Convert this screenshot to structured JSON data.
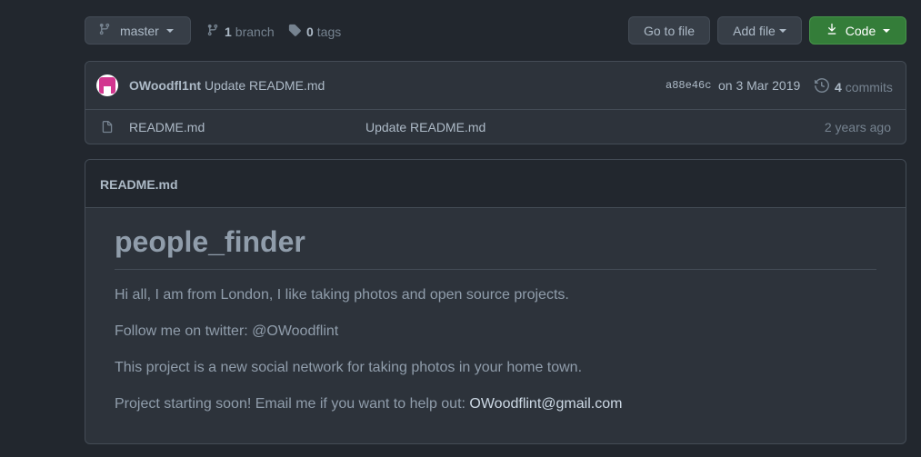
{
  "branch": {
    "current": "master",
    "branch_count": "1",
    "branch_label": "branch",
    "tag_count": "0",
    "tag_label": "tags"
  },
  "actions": {
    "goto_file": "Go to file",
    "add_file": "Add file",
    "code": "Code"
  },
  "commit": {
    "author": "OWoodfl1nt",
    "message": "Update README.md",
    "sha": "a88e46c",
    "date": "on 3 Mar 2019",
    "count": "4",
    "count_label": "commits"
  },
  "files": [
    {
      "name": "README.md",
      "last_commit": "Update README.md",
      "age": "2 years ago"
    }
  ],
  "readme": {
    "filename": "README.md",
    "heading": "people_finder",
    "paragraphs": [
      "Hi all, I am from London, I like taking photos and open source projects.",
      "Follow me on twitter: @OWoodflint",
      "This project is a new social network for taking photos in your home town.",
      "Project starting soon! Email me if you want to help out: "
    ],
    "email": "OWoodflint@gmail.com"
  }
}
